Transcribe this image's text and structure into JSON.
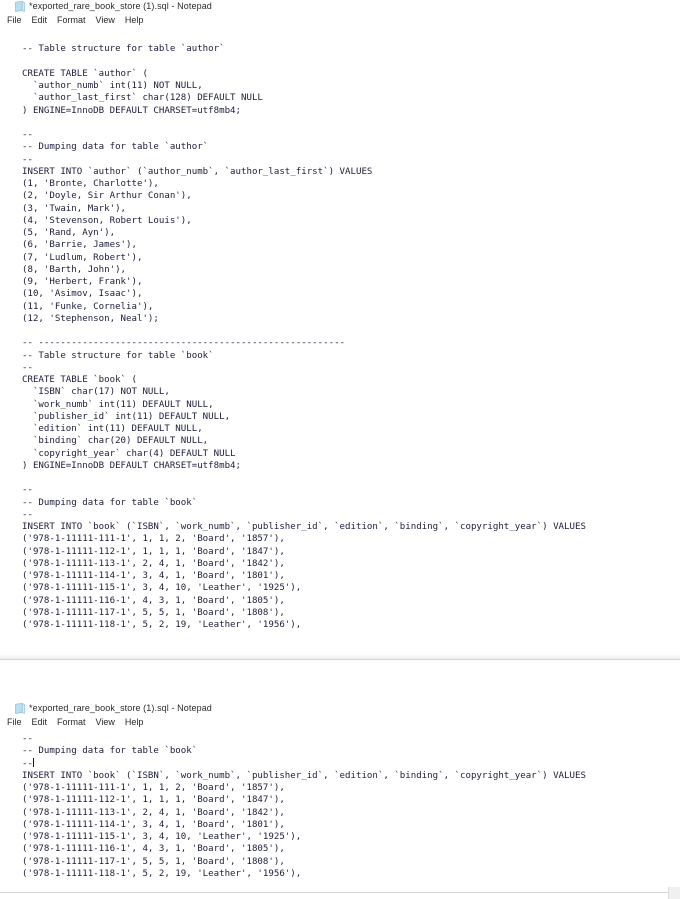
{
  "app": {
    "name": "Notepad",
    "icon": "notepad-document-icon",
    "menu": [
      "File",
      "Edit",
      "Format",
      "View",
      "Help"
    ],
    "text_color": "#1c1c3c",
    "background_color": "#ffffff"
  },
  "windows": [
    {
      "id": "window-one",
      "title": "*exported_rare_book_store (1).sql - Notepad",
      "lines": [
        "",
        "-- Table structure for table `author`",
        "",
        "CREATE TABLE `author` (",
        "  `author_numb` int(11) NOT NULL,",
        "  `author_last_first` char(128) DEFAULT NULL",
        ") ENGINE=InnoDB DEFAULT CHARSET=utf8mb4;",
        "",
        "--",
        "-- Dumping data for table `author`",
        "--",
        "INSERT INTO `author` (`author_numb`, `author_last_first`) VALUES",
        "(1, 'Bronte, Charlotte'),",
        "(2, 'Doyle, Sir Arthur Conan'),",
        "(3, 'Twain, Mark'),",
        "(4, 'Stevenson, Robert Louis'),",
        "(5, 'Rand, Ayn'),",
        "(6, 'Barrie, James'),",
        "(7, 'Ludlum, Robert'),",
        "(8, 'Barth, John'),",
        "(9, 'Herbert, Frank'),",
        "(10, 'Asimov, Isaac'),",
        "(11, 'Funke, Cornelia'),",
        "(12, 'Stephenson, Neal');",
        "",
        "-- --------------------------------------------------------",
        "-- Table structure for table `book`",
        "--",
        "CREATE TABLE `book` (",
        "  `ISBN` char(17) NOT NULL,",
        "  `work_numb` int(11) DEFAULT NULL,",
        "  `publisher_id` int(11) DEFAULT NULL,",
        "  `edition` int(11) DEFAULT NULL,",
        "  `binding` char(20) DEFAULT NULL,",
        "  `copyright_year` char(4) DEFAULT NULL",
        ") ENGINE=InnoDB DEFAULT CHARSET=utf8mb4;",
        "",
        "--",
        "-- Dumping data for table `book`",
        "--",
        "INSERT INTO `book` (`ISBN`, `work_numb`, `publisher_id`, `edition`, `binding`, `copyright_year`) VALUES",
        "('978-1-11111-111-1', 1, 1, 2, 'Board', '1857'),",
        "('978-1-11111-112-1', 1, 1, 1, 'Board', '1847'),",
        "('978-1-11111-113-1', 2, 4, 1, 'Board', '1842'),",
        "('978-1-11111-114-1', 3, 4, 1, 'Board', '1801'),",
        "('978-1-11111-115-1', 3, 4, 10, 'Leather', '1925'),",
        "('978-1-11111-116-1', 4, 3, 1, 'Board', '1805'),",
        "('978-1-11111-117-1', 5, 5, 1, 'Board', '1808'),",
        "('978-1-11111-118-1', 5, 2, 19, 'Leather', '1956'),"
      ]
    },
    {
      "id": "window-two",
      "title": "*exported_rare_book_store (1).sql - Notepad",
      "lines": [
        "--",
        "-- Dumping data for table `book`",
        "--",
        "INSERT INTO `book` (`ISBN`, `work_numb`, `publisher_id`, `edition`, `binding`, `copyright_year`) VALUES",
        "('978-1-11111-111-1', 1, 1, 2, 'Board', '1857'),",
        "('978-1-11111-112-1', 1, 1, 1, 'Board', '1847'),",
        "('978-1-11111-113-1', 2, 4, 1, 'Board', '1842'),",
        "('978-1-11111-114-1', 3, 4, 1, 'Board', '1801'),",
        "('978-1-11111-115-1', 3, 4, 10, 'Leather', '1925'),",
        "('978-1-11111-116-1', 4, 3, 1, 'Board', '1805'),",
        "('978-1-11111-117-1', 5, 5, 1, 'Board', '1808'),",
        "('978-1-11111-118-1', 5, 2, 19, 'Leather', '1956'),"
      ],
      "caret_line_index": 2
    }
  ]
}
